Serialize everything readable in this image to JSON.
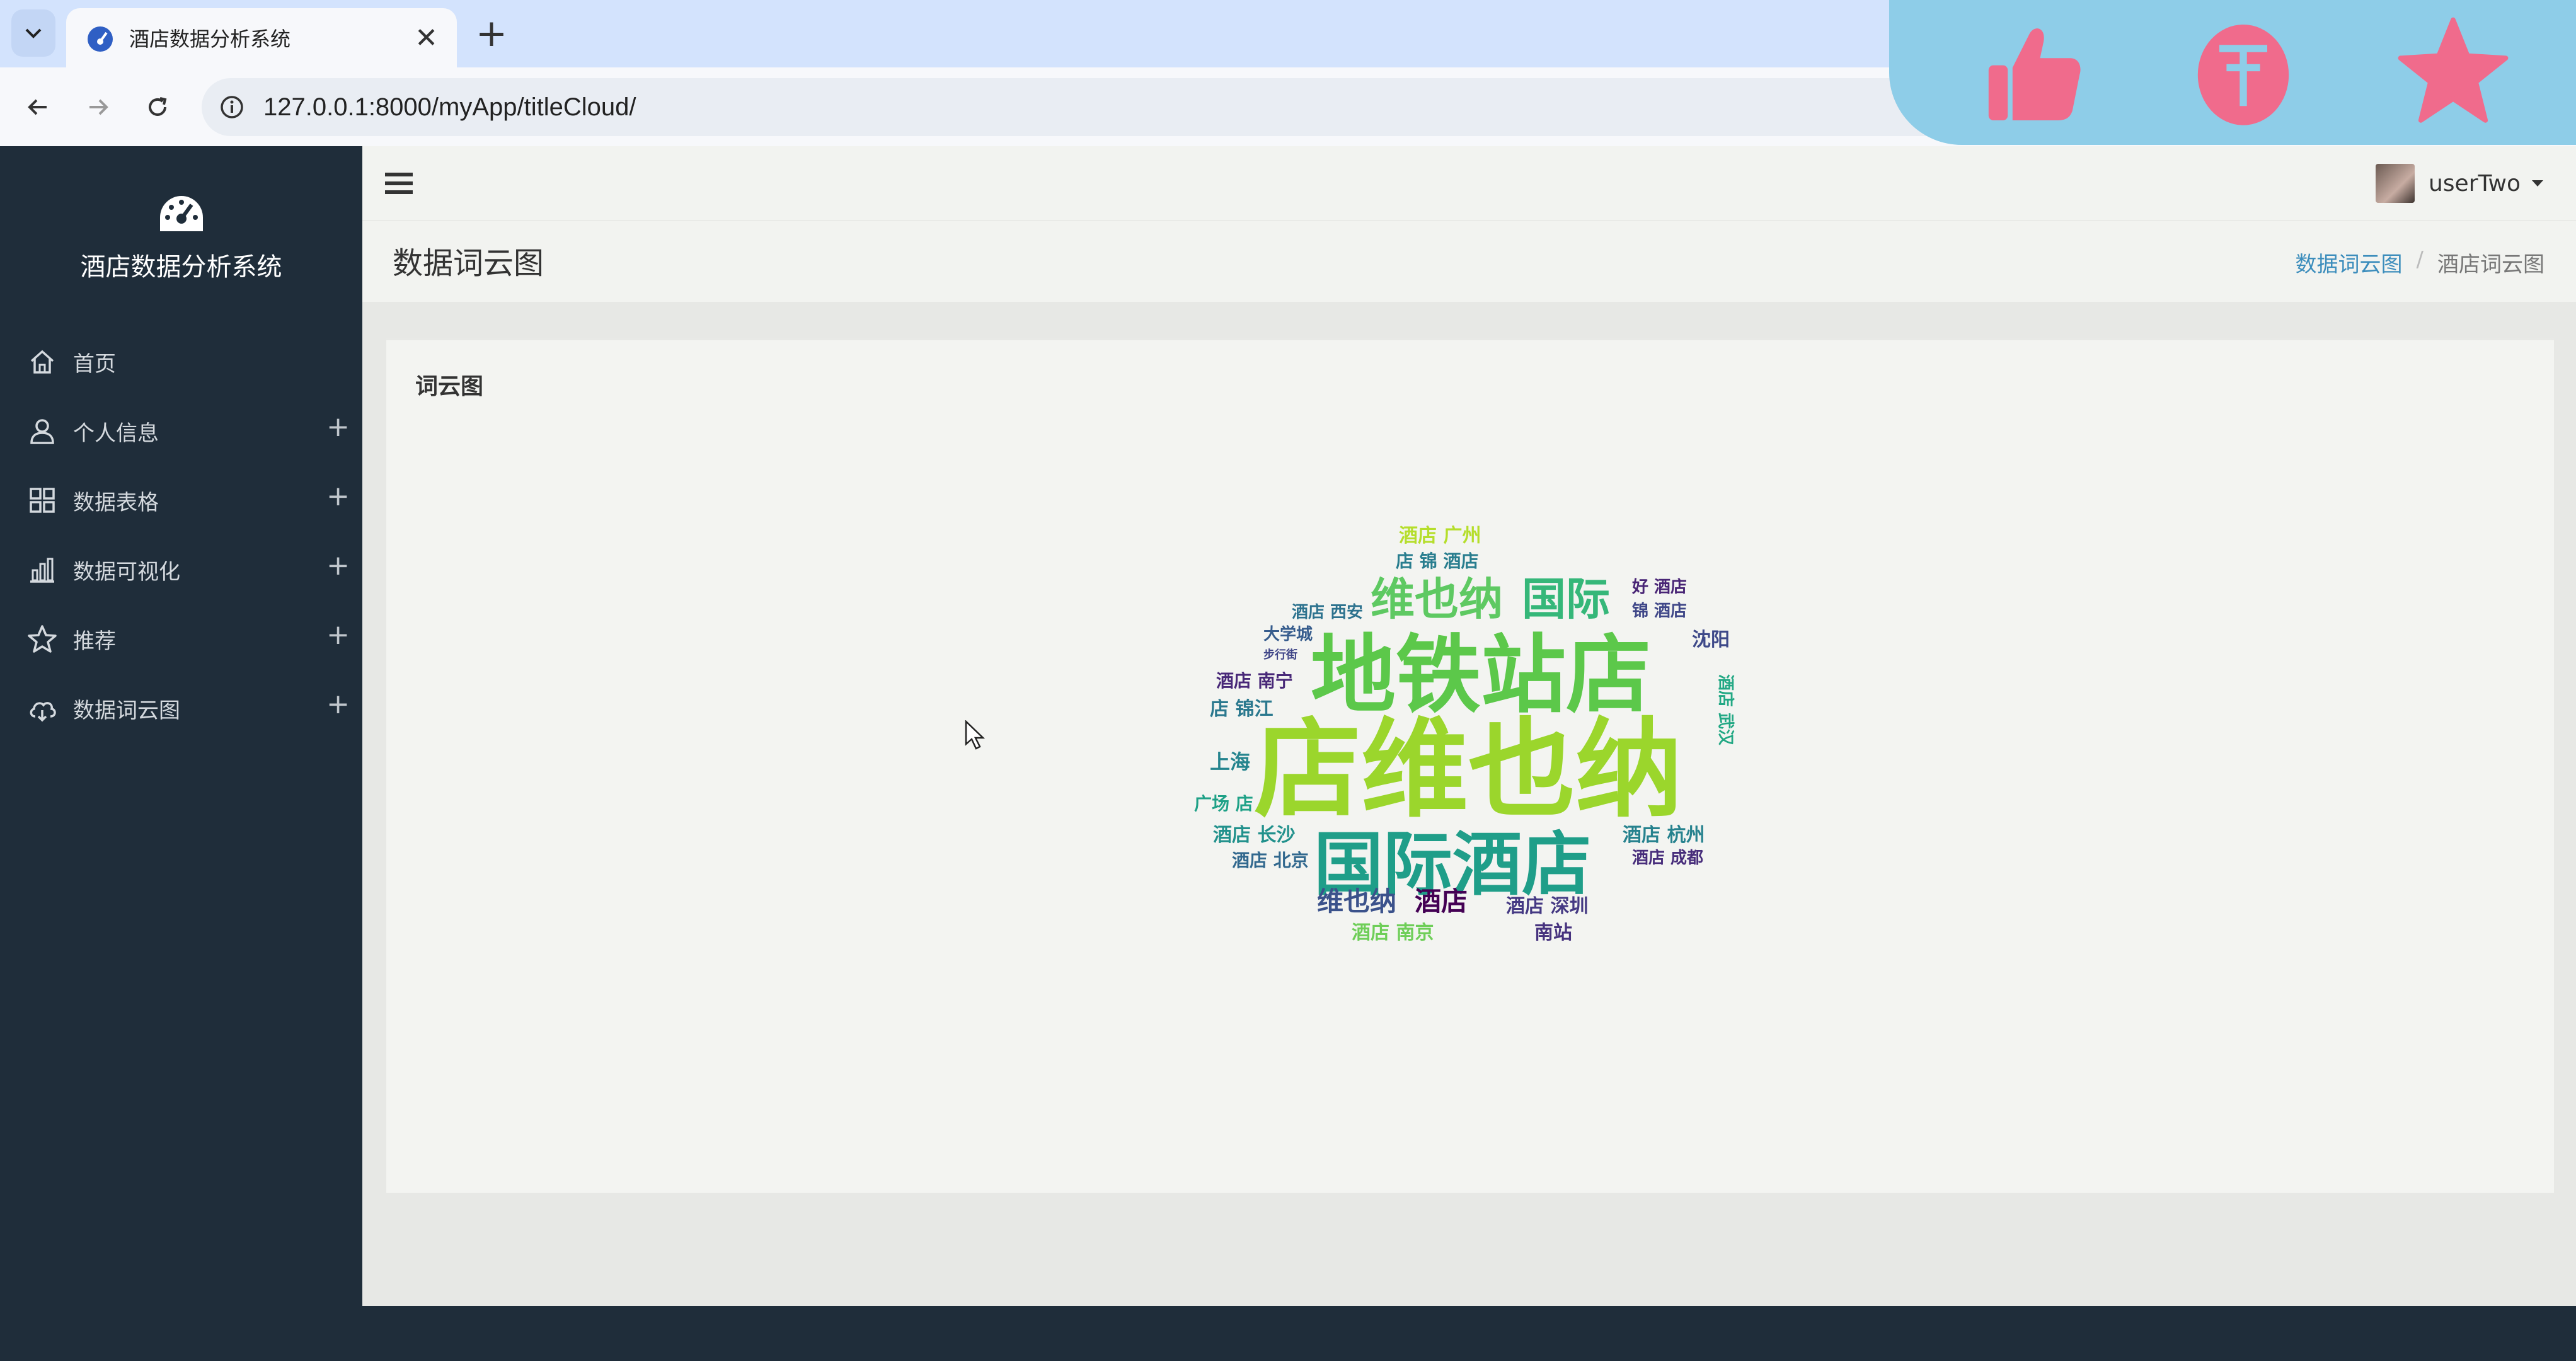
{
  "browser": {
    "tab_title": "酒店数据分析系统",
    "url": "127.0.0.1:8000/myApp/titleCloud/"
  },
  "sidebar": {
    "brand_title": "酒店数据分析系统",
    "items": [
      {
        "label": "首页",
        "icon": "home-icon",
        "expandable": false
      },
      {
        "label": "个人信息",
        "icon": "user-icon",
        "expandable": true
      },
      {
        "label": "数据表格",
        "icon": "grid-icon",
        "expandable": true
      },
      {
        "label": "数据可视化",
        "icon": "bar-chart-icon",
        "expandable": true
      },
      {
        "label": "推荐",
        "icon": "star-icon",
        "expandable": true
      },
      {
        "label": "数据词云图",
        "icon": "cloud-icon",
        "expandable": true
      }
    ]
  },
  "header": {
    "username": "userTwo"
  },
  "page": {
    "title": "数据词云图",
    "breadcrumb": [
      "数据词云图",
      "酒店词云图"
    ]
  },
  "card": {
    "title": "词云图"
  },
  "wordcloud": {
    "words": [
      {
        "text": "店维也纳",
        "color": "#9bd62c"
      },
      {
        "text": "地铁站店",
        "color": "#5cc84a"
      },
      {
        "text": "国际酒店",
        "color": "#1f9e89"
      },
      {
        "text": "维也纳",
        "color": "#5ec962"
      },
      {
        "text": "国际",
        "color": "#35b779"
      },
      {
        "text": "维也纳",
        "color": "#3b528b"
      },
      {
        "text": "酒店",
        "color": "#440154"
      },
      {
        "text": "酒店 广州",
        "color": "#b5de2b"
      },
      {
        "text": "酒店 杭州",
        "color": "#26828e"
      },
      {
        "text": "酒店 长沙",
        "color": "#21918c"
      },
      {
        "text": "酒店 北京",
        "color": "#31688e"
      },
      {
        "text": "酒店 深圳",
        "color": "#443983"
      },
      {
        "text": "酒店 南京",
        "color": "#6ece58"
      },
      {
        "text": "酒店 南宁",
        "color": "#482878"
      },
      {
        "text": "酒店 西安",
        "color": "#2c728e"
      },
      {
        "text": "酒店 成都",
        "color": "#472d7b"
      },
      {
        "text": "沈阳",
        "color": "#3e4989"
      },
      {
        "text": "上海",
        "color": "#25848e"
      },
      {
        "text": "广场 店",
        "color": "#1fa187"
      },
      {
        "text": "店 锦江",
        "color": "#2a788e"
      },
      {
        "text": "大学城",
        "color": "#365c8d"
      },
      {
        "text": "南站",
        "color": "#46327e"
      },
      {
        "text": "好 酒店",
        "color": "#482475"
      },
      {
        "text": "锦 酒店",
        "color": "#3f4788"
      },
      {
        "text": "店 锦 酒店",
        "color": "#287d8e"
      },
      {
        "text": "酒店 武汉",
        "color": "#22a884"
      },
      {
        "text": "步行街",
        "color": "#404688"
      }
    ]
  }
}
